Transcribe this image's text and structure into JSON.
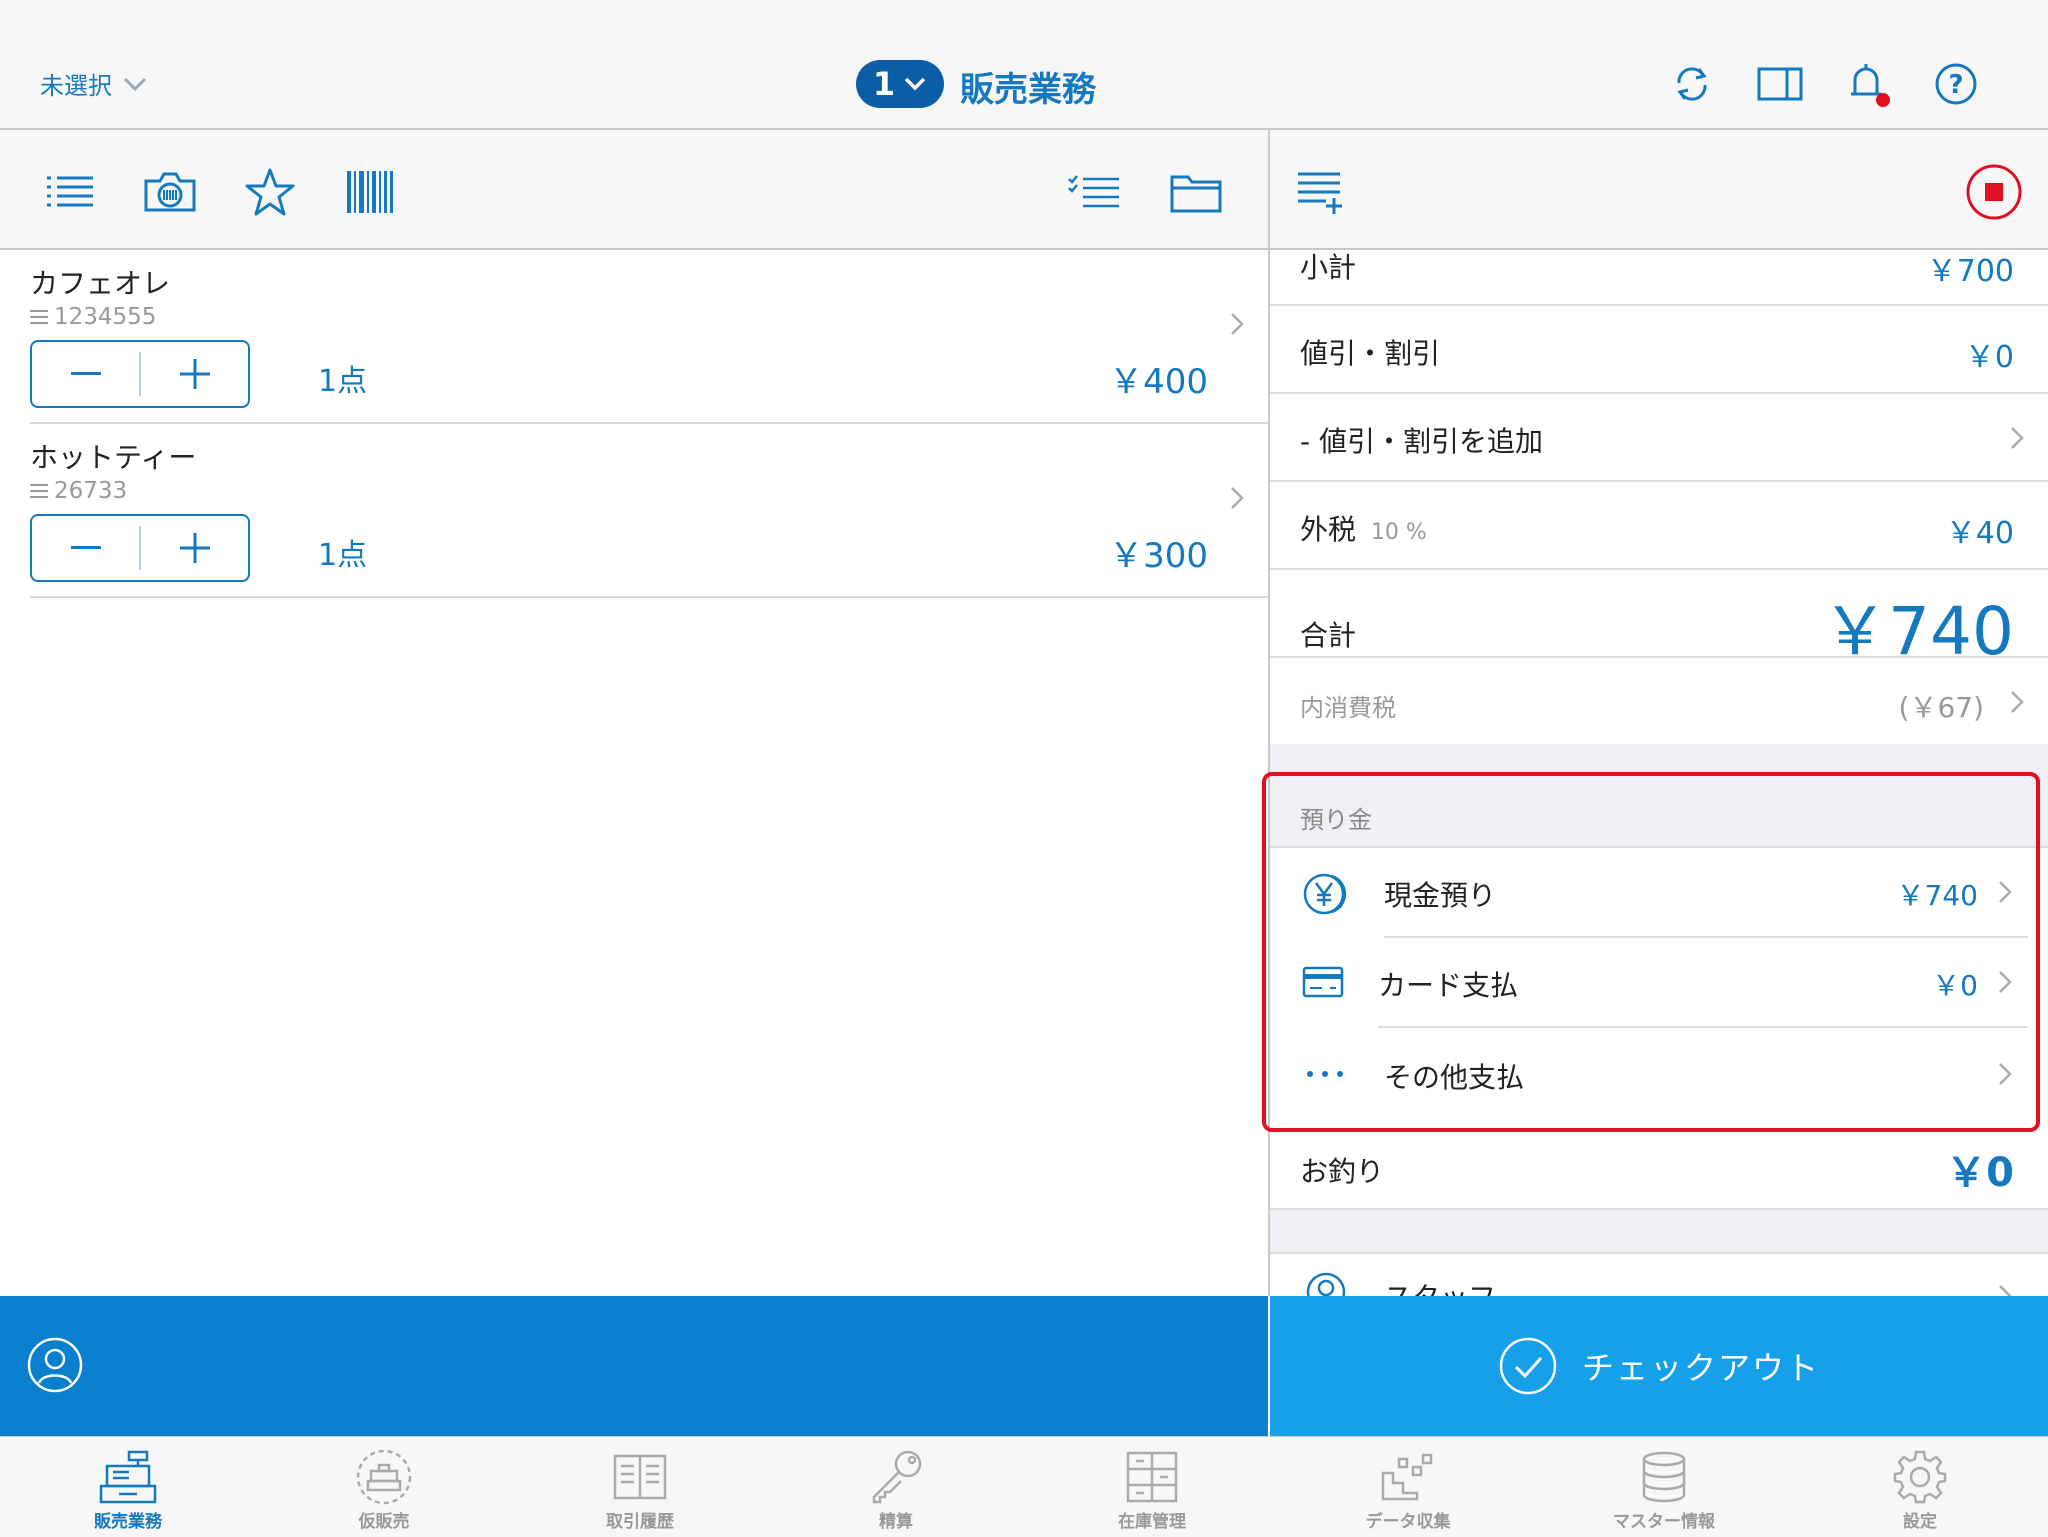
{
  "header": {
    "store_select": "未選択",
    "register_number": "1",
    "title": "販売業務"
  },
  "items": [
    {
      "name": "カフェオレ",
      "code": "1234555",
      "qty": "1点",
      "price": "￥400"
    },
    {
      "name": "ホットティー",
      "code": "26733",
      "qty": "1点",
      "price": "￥300"
    }
  ],
  "summary": {
    "subtotal_label": "小計",
    "subtotal_value": "￥700",
    "discount_label": "値引・割引",
    "discount_value": "￥0",
    "add_discount_label": "- 値引・割引を追加",
    "tax_label": "外税",
    "tax_rate": "10 %",
    "tax_value": "￥40",
    "total_label": "合計",
    "total_value": "￥740",
    "internal_tax_label": "内消費税",
    "internal_tax_value": "(￥67)"
  },
  "payments": {
    "section_label": "預り金",
    "cash_label": "現金預り",
    "cash_value": "￥740",
    "card_label": "カード支払",
    "card_value": "￥0",
    "other_label": "その他支払"
  },
  "change": {
    "label": "お釣り",
    "value": "￥0"
  },
  "staff": {
    "label": "スタッフ"
  },
  "checkout_label": "チェックアウト",
  "tabs": [
    {
      "label": "販売業務",
      "icon": "register-icon"
    },
    {
      "label": "仮販売",
      "icon": "temp-sale-icon"
    },
    {
      "label": "取引履歴",
      "icon": "history-icon"
    },
    {
      "label": "精算",
      "icon": "key-icon"
    },
    {
      "label": "在庫管理",
      "icon": "inventory-icon"
    },
    {
      "label": "データ収集",
      "icon": "data-collect-icon"
    },
    {
      "label": "マスター情報",
      "icon": "database-icon"
    },
    {
      "label": "設定",
      "icon": "gear-icon"
    }
  ],
  "colors": {
    "accent": "#1479bf",
    "checkout": "#16a0ea",
    "action_bar": "#0a7fce",
    "highlight": "#e01020",
    "stop": "#e01020"
  }
}
